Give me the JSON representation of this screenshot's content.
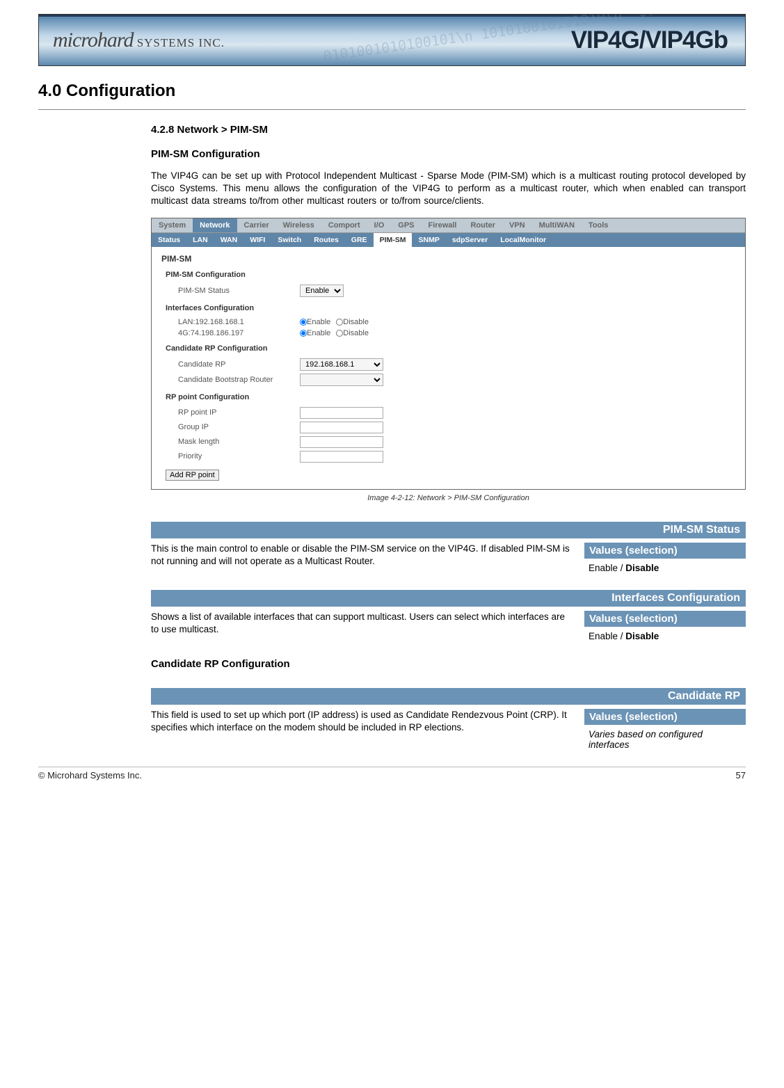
{
  "header": {
    "brand_main": "microhard",
    "brand_suffix": " SYSTEMS INC.",
    "product": "VIP4G/VIP4Gb"
  },
  "section_title": "4.0  Configuration",
  "subsection_title": "4.2.8 Network > PIM-SM",
  "config_heading": "PIM-SM Configuration",
  "intro_text": "The VIP4G can be set up with Protocol Independent Multicast - Sparse Mode (PIM-SM) which is a multicast routing protocol developed by Cisco Systems. This menu allows the configuration of the VIP4G to perform as a multicast router, which when enabled can transport multicast data streams to/from other multicast routers or to/from source/clients.",
  "screenshot": {
    "nav_top": [
      "System",
      "Network",
      "Carrier",
      "Wireless",
      "Comport",
      "I/O",
      "GPS",
      "Firewall",
      "Router",
      "VPN",
      "MultiWAN",
      "Tools"
    ],
    "nav_top_active": "Network",
    "nav_sub": [
      "Status",
      "LAN",
      "WAN",
      "WIFI",
      "Switch",
      "Routes",
      "GRE",
      "PIM-SM",
      "SNMP",
      "sdpServer",
      "LocalMonitor"
    ],
    "nav_sub_active": "PIM-SM",
    "panel_title": "PIM-SM",
    "sec1_title": "PIM-SM Configuration",
    "status_label": "PIM-SM Status",
    "status_value": "Enable",
    "sec2_title": "Interfaces Configuration",
    "if_rows": [
      {
        "label": "LAN:192.168.168.1",
        "enable": "Enable",
        "disable": "Disable"
      },
      {
        "label": "4G:74.198.186.197",
        "enable": "Enable",
        "disable": "Disable"
      }
    ],
    "sec3_title": "Candidate RP Configuration",
    "crp_label": "Candidate RP",
    "crp_value": "192.168.168.1",
    "cbr_label": "Candidate Bootstrap Router",
    "sec4_title": "RP point Configuration",
    "rp_rows": [
      "RP point IP",
      "Group IP",
      "Mask length",
      "Priority"
    ],
    "add_btn": "Add RP point"
  },
  "caption": "Image 4-2-12:  Network  > PIM-SM Configuration",
  "params": [
    {
      "title": "PIM-SM Status",
      "desc": "This is the main control to enable or disable the PIM-SM service on the VIP4G. If disabled PIM-SM is not running and will not operate as a Multicast Router.",
      "values_header": "Values (selection)",
      "values_html": "Enable / <b>Disable</b>"
    },
    {
      "title": "Interfaces Configuration",
      "desc": "Shows a list of available interfaces that can support multicast. Users can select which interfaces are to use multicast.",
      "values_header": "Values (selection)",
      "values_html": "Enable / <b>Disable</b>"
    }
  ],
  "candidate_heading": "Candidate RP Configuration",
  "param_crp": {
    "title": "Candidate RP",
    "desc": "This field is used to set up which port (IP address) is used as Candidate Rendezvous Point (CRP).  It specifies which interface on the modem should be included in RP elections.",
    "values_header": "Values (selection)",
    "values_html": "<span class='em'>Varies based on configured interfaces</span>"
  },
  "footer": {
    "left": "© Microhard Systems Inc.",
    "right": "57"
  }
}
